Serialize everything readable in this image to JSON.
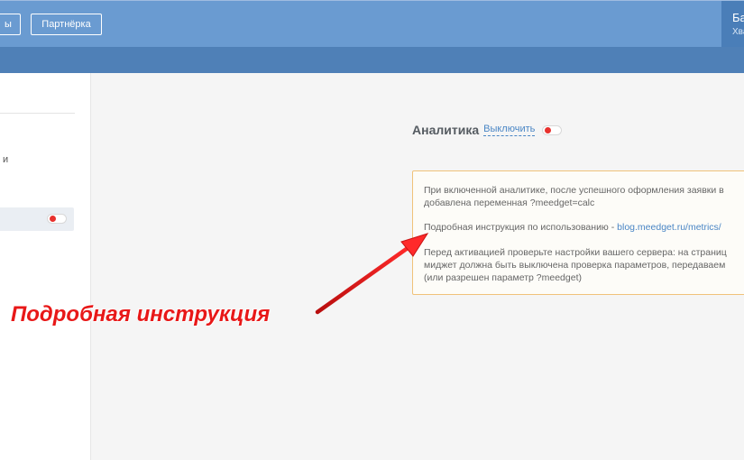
{
  "header": {
    "prev_button_label": "ы",
    "partner_button_label": "Партнёрка",
    "user_name": "Ба",
    "user_sub": "Хва"
  },
  "sidebar": {
    "item_text": "и"
  },
  "analytics": {
    "title": "Аналитика",
    "toggle_link": "Выключить",
    "enabled": true
  },
  "info": {
    "line1": "При включенной аналитике, после успешного оформления заявки в",
    "line2": "добавлена переменная ?meedget=calc",
    "instruction_prefix": "Подробная инструкция по использованию - ",
    "instruction_link": "blog.meedget.ru/metrics/",
    "warn1": "Перед активацией проверьте настройки вашего сервера: на страниц",
    "warn2": "миджет должна быть выключена проверка параметров, передаваем",
    "warn3": "(или разрешен параметр ?meedget)"
  },
  "annotation": {
    "text": "Подробная инструкция"
  },
  "colors": {
    "topbar": "#6a9bd1",
    "subbar": "#4f80b7",
    "toggle_knob": "#e8312d",
    "link": "#4a86c5",
    "info_border": "#f0c27a",
    "annotation": "#e81818"
  }
}
